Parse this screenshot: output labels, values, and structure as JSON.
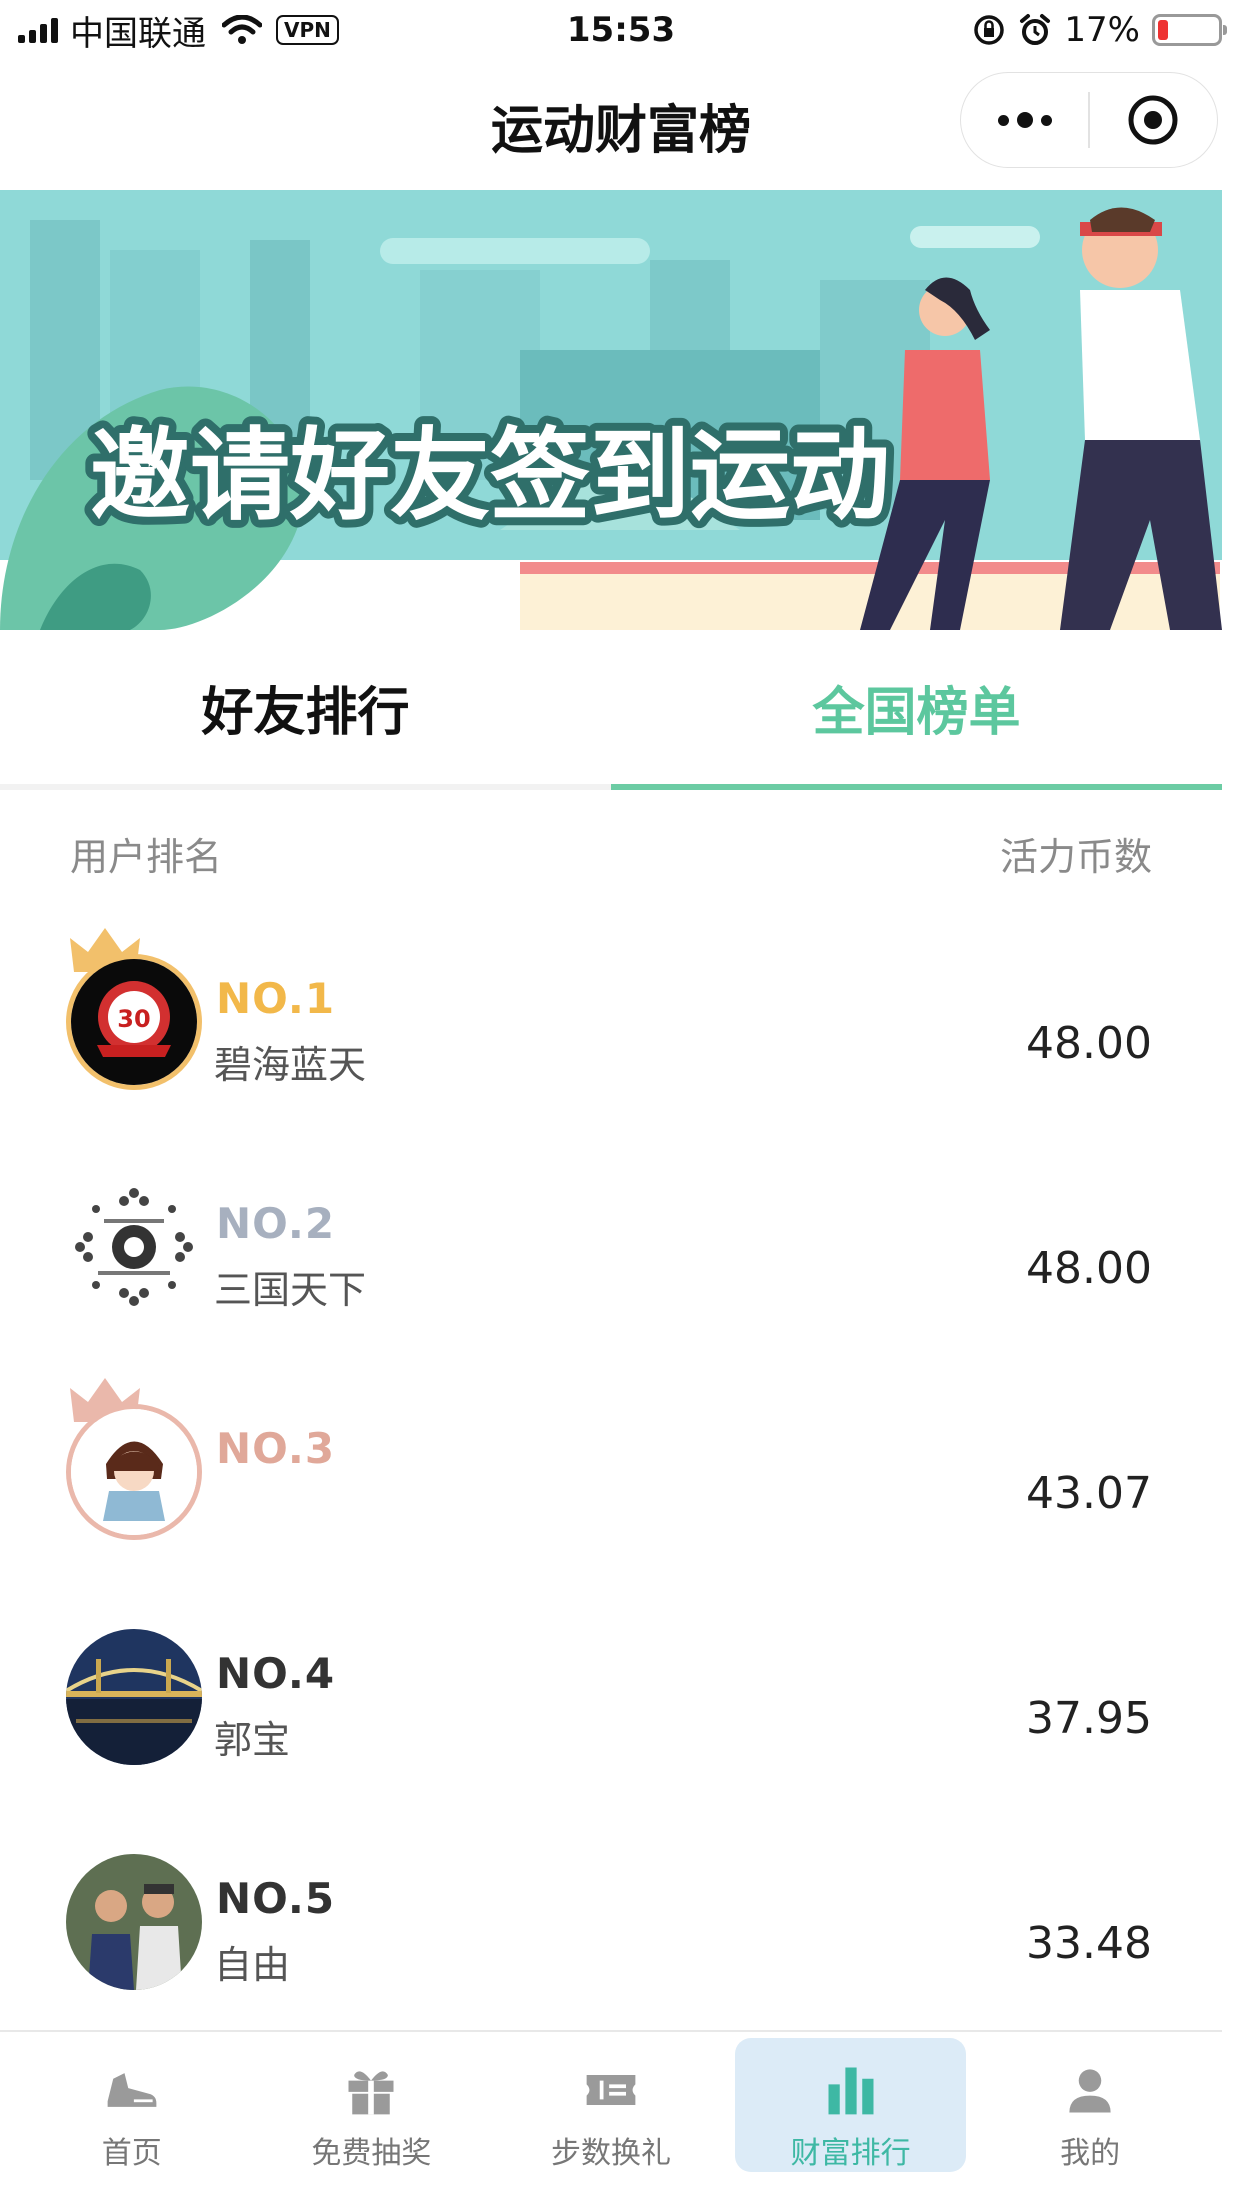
{
  "status_bar": {
    "carrier": "中国联通",
    "vpn": "VPN",
    "time": "15:53",
    "battery_percent": "17%",
    "battery_level": 0.17
  },
  "nav": {
    "title": "运动财富榜"
  },
  "banner": {
    "headline": "邀请好友签到运动"
  },
  "tabs": [
    {
      "label": "好友排行",
      "active": false
    },
    {
      "label": "全国榜单",
      "active": true
    }
  ],
  "list_header": {
    "left": "用户排名",
    "right": "活力币数"
  },
  "rankings": [
    {
      "rank": "NO.1",
      "name": "碧海蓝天",
      "score": "48.00"
    },
    {
      "rank": "NO.2",
      "name": "三国天下",
      "score": "48.00"
    },
    {
      "rank": "NO.3",
      "name": "",
      "score": "43.07"
    },
    {
      "rank": "NO.4",
      "name": "郭宝",
      "score": "37.95"
    },
    {
      "rank": "NO.5",
      "name": "自由",
      "score": "33.48"
    }
  ],
  "tab_bar": [
    {
      "label": "首页",
      "icon": "sneaker-icon"
    },
    {
      "label": "免费抽奖",
      "icon": "gift-icon"
    },
    {
      "label": "步数换礼",
      "icon": "ticket-icon"
    },
    {
      "label": "财富排行",
      "icon": "bar-chart-icon",
      "active": true
    },
    {
      "label": "我的",
      "icon": "person-icon"
    }
  ],
  "colors": {
    "accent": "#5cc79e",
    "gold": "#f2b84a",
    "silver": "#a7b0bf",
    "bronze": "#e0a899",
    "active_tab_bg": "#dcebf7"
  }
}
